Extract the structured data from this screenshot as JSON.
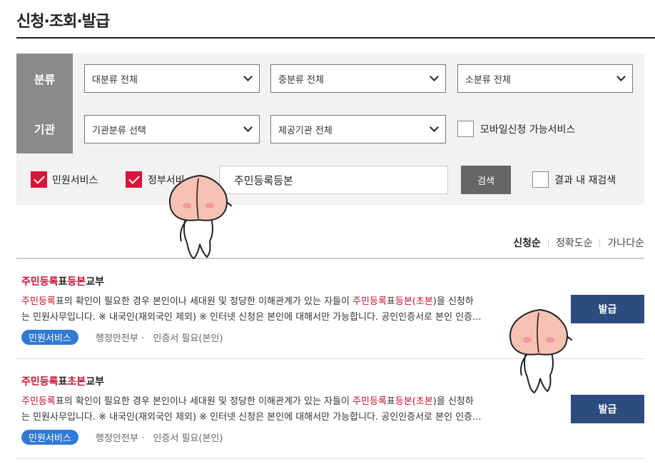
{
  "header": {
    "title": "신청·조회·발급"
  },
  "filters": {
    "category_label": "분류",
    "agency_label": "기관",
    "major_category": "대분류 전체",
    "mid_category": "중분류 전체",
    "minor_category": "소분류 전체",
    "agency_type": "기관분류 선택",
    "provider": "제공기관 전체",
    "mobile_label": "모바일신청 가능서비스",
    "civil_service_label": "민원서비스",
    "gov_service_label": "정부서비",
    "search_value": "주민등록등본",
    "search_button": "검색",
    "research_label": "결과 내 재검색"
  },
  "sort": {
    "options": [
      "신청순",
      "정확도순",
      "가나다순"
    ],
    "active": "신청순"
  },
  "results": [
    {
      "title_parts": [
        "주민등록",
        "표",
        "등본",
        "교부"
      ],
      "desc_line1": [
        "주민등록",
        "표의 확인이 필요한 경우 본인이나 세대원 및 정당한 이해관계가 있는 자들이 ",
        "주민등록",
        "표",
        "등본",
        "(",
        "초본",
        ")을 신청하"
      ],
      "desc_line2": "는 민원사무입니다. ※ 내국인(재외국인 제외) ※ 인터넷 신청은 본인에 대해서만 가능합니다. 공인인증서로 본인 인증...",
      "badge": "민원서비스",
      "agency": "행정안전부",
      "requirement": "인증서 필요(본인)",
      "button": "발급"
    },
    {
      "title_parts": [
        "주민등록",
        "표",
        "초본",
        "교부"
      ],
      "desc_line1": [
        "주민등록",
        "표의 확인이 필요한 경우 본인이나 세대원 및 정당한 이해관계가 있는 자들이 ",
        "주민등록",
        "표",
        "등본",
        "(",
        "초본",
        ")을 신청하"
      ],
      "desc_line2": "는 민원사무입니다. ※ 내국인(재외국인 제외) ※ 인터넷 신청은 본인에 대해서만 가능합니다. 공인인증서로 본인 인증...",
      "badge": "민원서비스",
      "agency": "행정안전부",
      "requirement": "인증서 필요(본인)",
      "button": "발급"
    }
  ],
  "colors": {
    "accent_red": "#c8102e",
    "badge_blue": "#2f7ad6",
    "button_navy": "#2c4b7f",
    "label_gray": "#8a8a8a"
  },
  "icons": {
    "select_arrow": "chevron-down-icon",
    "check": "checkmark-icon",
    "mascot": "peach-mascot-icon"
  }
}
